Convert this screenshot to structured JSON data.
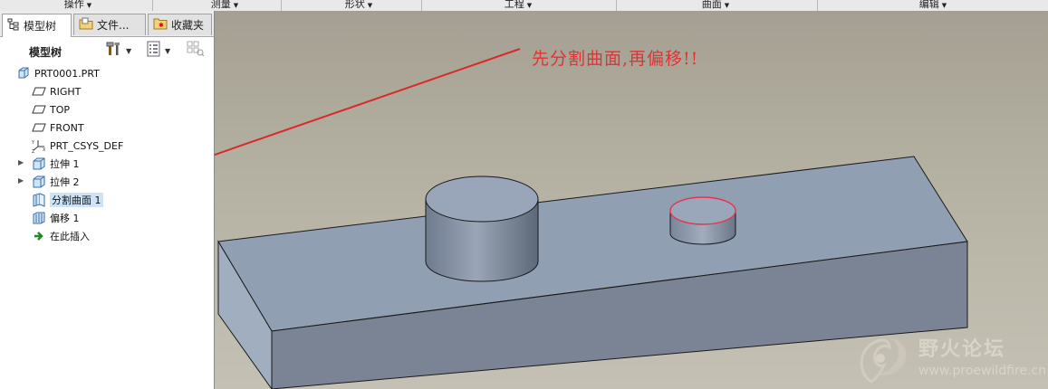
{
  "top_menu": [
    {
      "label": "操作"
    },
    {
      "label": "测量"
    },
    {
      "label": "形状"
    },
    {
      "label": "工程"
    },
    {
      "label": "曲面"
    },
    {
      "label": "编辑"
    }
  ],
  "tabs": [
    {
      "label": "模型树",
      "icon": "model-tree-icon"
    },
    {
      "label": "文件...",
      "icon": "folder-icon"
    },
    {
      "label": "收藏夹",
      "icon": "favorites-icon"
    }
  ],
  "tree_title": "模型树",
  "tree": {
    "root": "PRT0001.PRT",
    "items": [
      {
        "label": "RIGHT",
        "icon": "datum-plane-icon"
      },
      {
        "label": "TOP",
        "icon": "datum-plane-icon"
      },
      {
        "label": "FRONT",
        "icon": "datum-plane-icon"
      },
      {
        "label": "PRT_CSYS_DEF",
        "icon": "csys-icon"
      },
      {
        "label": "拉伸 1",
        "icon": "extrude-icon",
        "expandable": true
      },
      {
        "label": "拉伸 2",
        "icon": "extrude-icon",
        "expandable": true
      },
      {
        "label": "分割曲面 1",
        "icon": "split-surface-icon",
        "selected": true
      },
      {
        "label": "偏移 1",
        "icon": "offset-icon"
      },
      {
        "label": "在此插入",
        "icon": "insert-here-arrow-icon"
      }
    ]
  },
  "annotation": "先分割曲面,再偏移!!",
  "watermark": {
    "title": "野火论坛",
    "url": "www.proewildfire.cn"
  },
  "colors": {
    "annotation": "#e23333",
    "model": "#8e9bae",
    "background": "#b2ae9f"
  }
}
